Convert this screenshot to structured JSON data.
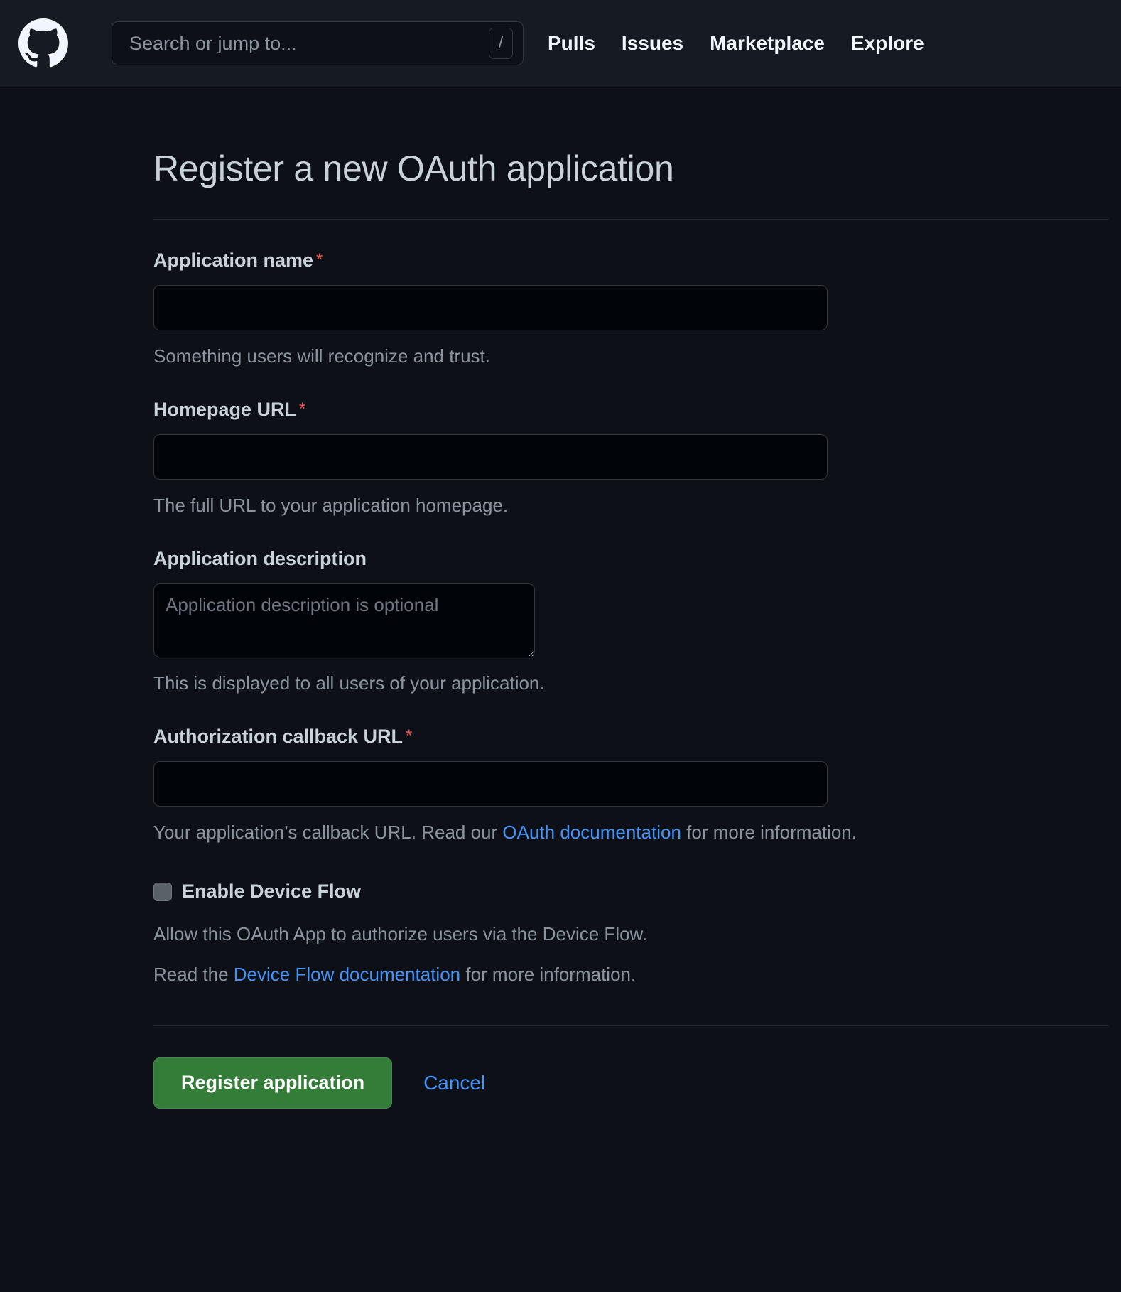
{
  "header": {
    "logo_icon": "github-mark-icon",
    "search": {
      "placeholder": "Search or jump to...",
      "shortcut_key": "/"
    },
    "nav_items": [
      {
        "label": "Pulls"
      },
      {
        "label": "Issues"
      },
      {
        "label": "Marketplace"
      },
      {
        "label": "Explore"
      }
    ]
  },
  "page": {
    "title": "Register a new OAuth application"
  },
  "form": {
    "application_name": {
      "label": "Application name",
      "required_marker": "*",
      "value": "",
      "placeholder": "",
      "help": "Something users will recognize and trust."
    },
    "homepage_url": {
      "label": "Homepage URL",
      "required_marker": "*",
      "value": "",
      "placeholder": "",
      "help": "The full URL to your application homepage."
    },
    "application_description": {
      "label": "Application description",
      "value": "",
      "placeholder": "Application description is optional",
      "help": "This is displayed to all users of your application."
    },
    "authorization_callback_url": {
      "label": "Authorization callback URL",
      "required_marker": "*",
      "value": "",
      "placeholder": "",
      "help_before_link": "Your application’s callback URL. Read our ",
      "help_link": "OAuth documentation",
      "help_after_link": " for more information."
    },
    "device_flow": {
      "label": "Enable Device Flow",
      "checked": false,
      "description": "Allow this OAuth App to authorize users via the Device Flow.",
      "read_before_link": "Read the ",
      "read_link": "Device Flow documentation",
      "read_after_link": " for more information."
    },
    "actions": {
      "submit_label": "Register application",
      "cancel_label": "Cancel"
    }
  },
  "colors": {
    "page_background": "#0d1117",
    "header_background": "#161b22",
    "input_background": "#010409",
    "border": "#30363d",
    "text_primary": "#c9d1d9",
    "text_muted": "#8b949e",
    "link": "#4493f8",
    "required_star": "#f85149",
    "primary_button": "#347d39"
  }
}
